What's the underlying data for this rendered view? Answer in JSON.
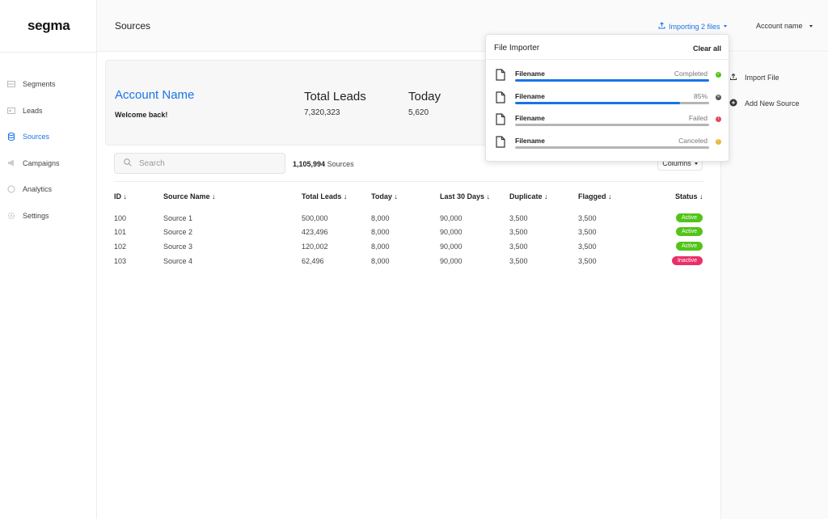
{
  "app": {
    "logo": "segma"
  },
  "sidebar": {
    "items": [
      {
        "label": "Segments",
        "icon": "segments-icon",
        "active": false
      },
      {
        "label": "Leads",
        "icon": "leads-icon",
        "active": false
      },
      {
        "label": "Sources",
        "icon": "database-icon",
        "active": true
      },
      {
        "label": "Campaigns",
        "icon": "megaphone-icon",
        "active": false
      },
      {
        "label": "Analytics",
        "icon": "analytics-icon",
        "active": false
      },
      {
        "label": "Settings",
        "icon": "gear-icon",
        "active": false
      }
    ]
  },
  "header": {
    "title": "Sources",
    "importing_label": "Importing 2 files",
    "account_label": "Account name"
  },
  "welcome": {
    "account_name": "Account Name",
    "message": "Welcome back!",
    "stats": [
      {
        "label": "Total Leads",
        "value": "7,320,323"
      },
      {
        "label": "Today",
        "value": "5,620"
      }
    ]
  },
  "toolbar": {
    "search_placeholder": "Search",
    "count_value": "1,105,994",
    "count_unit": "Sources",
    "columns_label": "Columns"
  },
  "table": {
    "headers": [
      "ID",
      "Source Name",
      "Total Leads",
      "Today",
      "Last 30 Days",
      "Duplicate",
      "Flagged",
      "Status"
    ],
    "rows": [
      {
        "id": "100",
        "name": "Source 1",
        "total": "500,000",
        "today": "8,000",
        "last30": "90,000",
        "duplicate": "3,500",
        "flagged": "3,500",
        "status": "Active"
      },
      {
        "id": "101",
        "name": "Source 2",
        "total": "423,496",
        "today": "8,000",
        "last30": "90,000",
        "duplicate": "3,500",
        "flagged": "3,500",
        "status": "Active"
      },
      {
        "id": "102",
        "name": "Source 3",
        "total": "120,002",
        "today": "8,000",
        "last30": "90,000",
        "duplicate": "3,500",
        "flagged": "3,500",
        "status": "Active"
      },
      {
        "id": "103",
        "name": "Source 4",
        "total": "62,496",
        "today": "8,000",
        "last30": "90,000",
        "duplicate": "3,500",
        "flagged": "3,500",
        "status": "Inactive"
      }
    ]
  },
  "actions": [
    {
      "label": "Import File",
      "icon": "upload-icon"
    },
    {
      "label": "Add New Source",
      "icon": "plus-circle-icon"
    }
  ],
  "importer": {
    "title": "File Importer",
    "clear_label": "Clear all",
    "files": [
      {
        "name": "Filename",
        "status": "Completed",
        "progress": 1.0,
        "state": "completed"
      },
      {
        "name": "Filename",
        "status": "85%",
        "progress": 0.85,
        "state": "in-progress"
      },
      {
        "name": "Filename",
        "status": "Failed",
        "progress": 0,
        "state": "failed"
      },
      {
        "name": "Filename",
        "status": "Canceled",
        "progress": 0,
        "state": "canceled"
      }
    ]
  },
  "colors": {
    "accent": "#1a73e8",
    "active_badge": "#52c41a",
    "inactive_badge": "#eb2f6b",
    "completed": "#52c41a",
    "in_progress": "#555555",
    "failed": "#e04b5a",
    "canceled": "#e8b93b"
  }
}
